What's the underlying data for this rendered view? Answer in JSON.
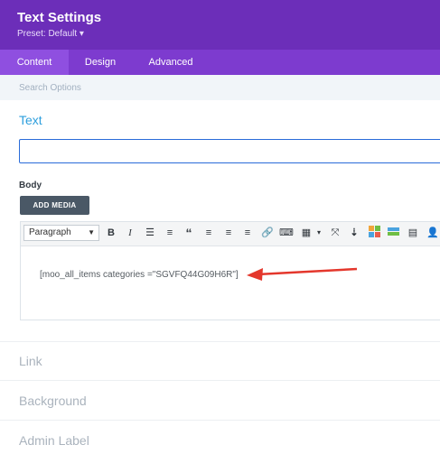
{
  "header": {
    "title": "Text Settings",
    "preset": "Preset: Default ▾"
  },
  "tabs": [
    {
      "label": "Content",
      "active": true
    },
    {
      "label": "Design",
      "active": false
    },
    {
      "label": "Advanced",
      "active": false
    }
  ],
  "search": {
    "placeholder": "Search Options"
  },
  "sections": {
    "text": "Text",
    "link": "Link",
    "background": "Background",
    "admin_label": "Admin Label"
  },
  "text_field": {
    "value": ""
  },
  "body": {
    "label": "Body",
    "add_media": "ADD MEDIA",
    "format_select": "Paragraph",
    "content": "[moo_all_items categories =\"SGVFQ44G09H6R\"]"
  },
  "toolbar_icons": [
    "bold-icon",
    "italic-icon",
    "unordered-list-icon",
    "ordered-list-icon",
    "blockquote-icon",
    "align-left-icon",
    "align-center-icon",
    "align-right-icon",
    "link-icon",
    "keyboard-icon",
    "table-icon",
    "fullscreen-icon",
    "insert-above-icon",
    "color-grid-icon",
    "color-bar-icon",
    "menu-icon",
    "user-icon"
  ],
  "colors": {
    "header_bg": "#6c2eb9",
    "tabs_bg": "#7d3bcf",
    "active_tab": "#8f4fe0",
    "section_blue": "#2e9fdd",
    "arrow_red": "#e4372c"
  }
}
